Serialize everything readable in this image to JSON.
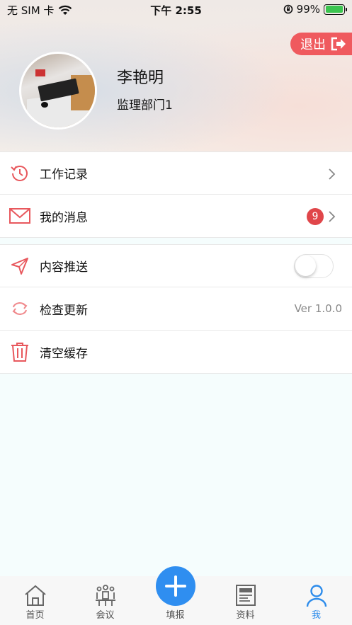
{
  "status_bar": {
    "carrier": "无 SIM 卡",
    "time": "下午 2:55",
    "battery": "99%",
    "battery_level": 0.99
  },
  "header": {
    "logout_label": "退出",
    "user_name": "李艳明",
    "department": "监理部门1"
  },
  "menu": {
    "group1": [
      {
        "label": "工作记录",
        "icon": "history-icon"
      },
      {
        "label": "我的消息",
        "icon": "mail-icon",
        "badge": "9"
      }
    ],
    "group2": [
      {
        "label": "内容推送",
        "icon": "send-icon",
        "toggle_on": false
      },
      {
        "label": "检查更新",
        "icon": "refresh-icon",
        "version": "Ver 1.0.0"
      },
      {
        "label": "清空缓存",
        "icon": "trash-icon"
      }
    ]
  },
  "tabbar": {
    "tabs": [
      {
        "label": "首页",
        "icon": "home-icon"
      },
      {
        "label": "会议",
        "icon": "meeting-icon"
      },
      {
        "label": "填报",
        "icon": "plus-icon"
      },
      {
        "label": "资料",
        "icon": "document-icon"
      },
      {
        "label": "我",
        "icon": "user-icon",
        "active": true
      }
    ]
  },
  "colors": {
    "accent_red": "#ef5a5e",
    "accent_blue": "#2f8ef0",
    "badge_red": "#e0464a"
  }
}
